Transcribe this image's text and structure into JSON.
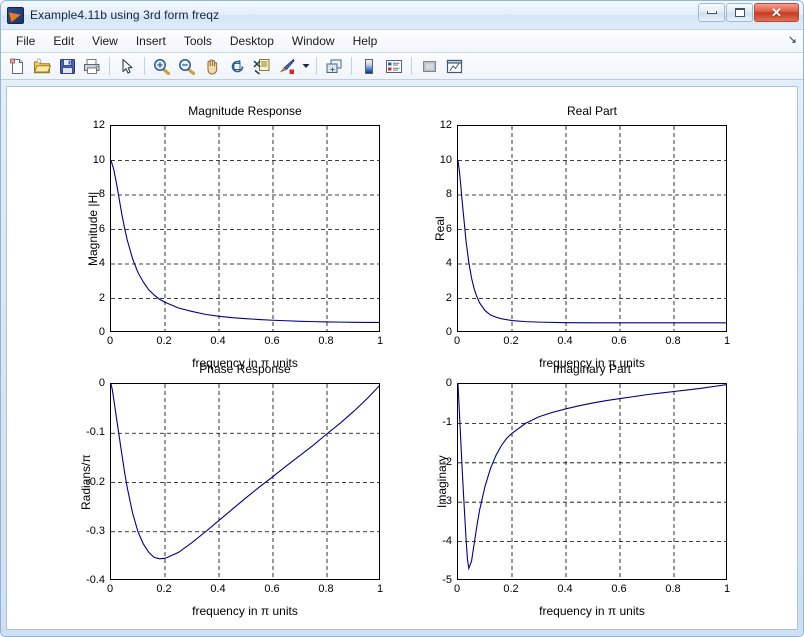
{
  "window": {
    "title": "Example4.11b  using 3rd form freqz",
    "app_icon": "matlab-icon",
    "controls": {
      "minimize": "minimize-button",
      "maximize": "maximize-button",
      "close": "close-button"
    }
  },
  "menubar": {
    "items": [
      {
        "label": "File"
      },
      {
        "label": "Edit"
      },
      {
        "label": "View"
      },
      {
        "label": "Insert"
      },
      {
        "label": "Tools"
      },
      {
        "label": "Desktop"
      },
      {
        "label": "Window"
      },
      {
        "label": "Help"
      }
    ],
    "dock_control": "↘"
  },
  "toolbar": {
    "buttons": [
      {
        "name": "new-figure-icon",
        "tooltip": "New Figure"
      },
      {
        "name": "open-file-icon",
        "tooltip": "Open File"
      },
      {
        "name": "save-figure-icon",
        "tooltip": "Save Figure"
      },
      {
        "name": "print-figure-icon",
        "tooltip": "Print Figure"
      },
      {
        "name": "pointer-icon",
        "tooltip": "Edit Plot"
      },
      {
        "name": "zoom-in-icon",
        "tooltip": "Zoom In"
      },
      {
        "name": "zoom-out-icon",
        "tooltip": "Zoom Out"
      },
      {
        "name": "pan-hand-icon",
        "tooltip": "Pan"
      },
      {
        "name": "rotate-3d-icon",
        "tooltip": "Rotate 3D"
      },
      {
        "name": "data-cursor-icon",
        "tooltip": "Data Cursor"
      },
      {
        "name": "brush-icon",
        "tooltip": "Brush/Select Data"
      },
      {
        "name": "link-data-icon",
        "tooltip": "Link Plot"
      },
      {
        "name": "colorbar-icon",
        "tooltip": "Insert Colorbar"
      },
      {
        "name": "legend-icon",
        "tooltip": "Insert Legend"
      },
      {
        "name": "hide-plot-tools-icon",
        "tooltip": "Hide Plot Tools"
      },
      {
        "name": "show-plot-tools-icon",
        "tooltip": "Show Plot Tools"
      }
    ]
  },
  "chart_data": [
    {
      "type": "line",
      "name": "magnitude-response",
      "title": "Magnitude Response",
      "xlabel": "frequency in π units",
      "ylabel": "Magnitude |H|",
      "xlim": [
        0,
        1
      ],
      "ylim": [
        0,
        12
      ],
      "xticks": [
        0,
        0.2,
        0.4,
        0.6,
        0.8,
        1
      ],
      "xticklabels": [
        "0",
        "0.2",
        "0.4",
        "0.6",
        "0.8",
        "1"
      ],
      "yticks": [
        0,
        2,
        4,
        6,
        8,
        10,
        12
      ],
      "yticklabels": [
        "0",
        "2",
        "4",
        "6",
        "8",
        "10",
        "12"
      ],
      "grid": true,
      "line_color": "#00008B",
      "x": [
        0,
        0.01,
        0.02,
        0.03,
        0.04,
        0.05,
        0.06,
        0.08,
        0.1,
        0.12,
        0.14,
        0.16,
        0.18,
        0.2,
        0.25,
        0.3,
        0.35,
        0.4,
        0.45,
        0.5,
        0.55,
        0.6,
        0.65,
        0.7,
        0.75,
        0.8,
        0.85,
        0.9,
        0.95,
        1.0
      ],
      "y": [
        10.0,
        9.5,
        8.7,
        7.8,
        6.9,
        6.1,
        5.4,
        4.3,
        3.5,
        2.95,
        2.5,
        2.2,
        1.95,
        1.78,
        1.45,
        1.25,
        1.08,
        0.97,
        0.89,
        0.83,
        0.78,
        0.74,
        0.71,
        0.68,
        0.66,
        0.64,
        0.63,
        0.62,
        0.61,
        0.61
      ]
    },
    {
      "type": "line",
      "name": "real-part",
      "title": "Real Part",
      "xlabel": "frequency in π units",
      "ylabel": "Real",
      "xlim": [
        0,
        1
      ],
      "ylim": [
        0,
        12
      ],
      "xticks": [
        0,
        0.2,
        0.4,
        0.6,
        0.8,
        1
      ],
      "xticklabels": [
        "0",
        "0.2",
        "0.4",
        "0.6",
        "0.8",
        "1"
      ],
      "yticks": [
        0,
        2,
        4,
        6,
        8,
        10,
        12
      ],
      "yticklabels": [
        "0",
        "2",
        "4",
        "6",
        "8",
        "10",
        "12"
      ],
      "grid": true,
      "line_color": "#00008B",
      "x": [
        0,
        0.005,
        0.01,
        0.015,
        0.02,
        0.03,
        0.04,
        0.05,
        0.06,
        0.07,
        0.08,
        0.1,
        0.12,
        0.14,
        0.16,
        0.2,
        0.25,
        0.3,
        0.4,
        0.5,
        0.6,
        0.7,
        0.8,
        0.9,
        1.0
      ],
      "y": [
        10.0,
        9.4,
        8.6,
        7.7,
        6.9,
        5.3,
        4.1,
        3.2,
        2.55,
        2.1,
        1.75,
        1.3,
        1.05,
        0.92,
        0.83,
        0.72,
        0.66,
        0.63,
        0.6,
        0.59,
        0.59,
        0.59,
        0.59,
        0.59,
        0.59
      ]
    },
    {
      "type": "line",
      "name": "phase-response",
      "title": "Phase Response",
      "xlabel": "frequency in π units",
      "ylabel": "Radians/π",
      "xlim": [
        0,
        1
      ],
      "ylim": [
        -0.4,
        0
      ],
      "xticks": [
        0,
        0.2,
        0.4,
        0.6,
        0.8,
        1
      ],
      "xticklabels": [
        "0",
        "0.2",
        "0.4",
        "0.6",
        "0.8",
        "1"
      ],
      "yticks": [
        -0.4,
        -0.3,
        -0.2,
        -0.1,
        0
      ],
      "yticklabels": [
        "-0.4",
        "-0.3",
        "-0.2",
        "-0.1",
        "0"
      ],
      "grid": true,
      "line_color": "#00008B",
      "x": [
        0,
        0.005,
        0.01,
        0.02,
        0.03,
        0.04,
        0.05,
        0.06,
        0.08,
        0.1,
        0.12,
        0.14,
        0.16,
        0.18,
        0.2,
        0.25,
        0.3,
        0.35,
        0.4,
        0.45,
        0.5,
        0.55,
        0.6,
        0.65,
        0.7,
        0.75,
        0.8,
        0.85,
        0.9,
        0.95,
        1.0
      ],
      "y": [
        0,
        -0.012,
        -0.03,
        -0.068,
        -0.105,
        -0.142,
        -0.178,
        -0.21,
        -0.262,
        -0.3,
        -0.325,
        -0.342,
        -0.352,
        -0.355,
        -0.354,
        -0.342,
        -0.322,
        -0.3,
        -0.277,
        -0.254,
        -0.231,
        -0.209,
        -0.188,
        -0.166,
        -0.145,
        -0.124,
        -0.101,
        -0.079,
        -0.055,
        -0.029,
        0
      ]
    },
    {
      "type": "line",
      "name": "imaginary-part",
      "title": "Imaginary Part",
      "xlabel": "frequency in π units",
      "ylabel": "Imaginary",
      "xlim": [
        0,
        1
      ],
      "ylim": [
        -5,
        0
      ],
      "xticks": [
        0,
        0.2,
        0.4,
        0.6,
        0.8,
        1
      ],
      "xticklabels": [
        "0",
        "0.2",
        "0.4",
        "0.6",
        "0.8",
        "1"
      ],
      "yticks": [
        -5,
        -4,
        -3,
        -2,
        -1,
        0
      ],
      "yticklabels": [
        "-5",
        "-4",
        "-3",
        "-2",
        "-1",
        "0"
      ],
      "grid": true,
      "line_color": "#00008B",
      "x": [
        0,
        0.005,
        0.01,
        0.015,
        0.02,
        0.025,
        0.03,
        0.035,
        0.04,
        0.05,
        0.06,
        0.07,
        0.08,
        0.1,
        0.12,
        0.14,
        0.16,
        0.18,
        0.2,
        0.25,
        0.3,
        0.35,
        0.4,
        0.45,
        0.5,
        0.55,
        0.6,
        0.65,
        0.7,
        0.75,
        0.8,
        0.85,
        0.9,
        0.95,
        1.0
      ],
      "y": [
        0,
        -0.7,
        -1.4,
        -2.1,
        -2.75,
        -3.35,
        -3.95,
        -4.45,
        -4.68,
        -4.5,
        -4.05,
        -3.6,
        -3.2,
        -2.6,
        -2.15,
        -1.82,
        -1.57,
        -1.38,
        -1.25,
        -1.0,
        -0.83,
        -0.72,
        -0.63,
        -0.55,
        -0.48,
        -0.42,
        -0.37,
        -0.32,
        -0.27,
        -0.23,
        -0.19,
        -0.15,
        -0.11,
        -0.06,
        -0.01
      ]
    }
  ]
}
